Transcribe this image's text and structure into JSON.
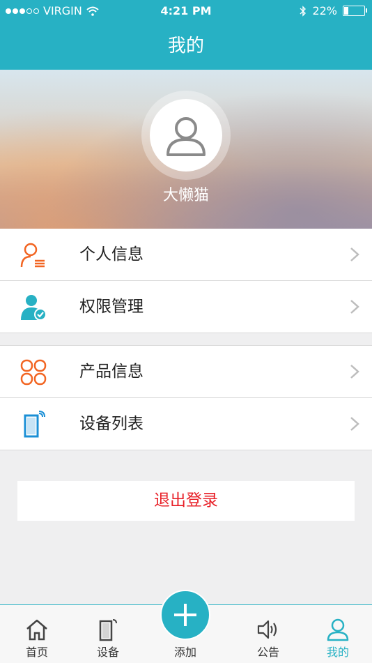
{
  "status_bar": {
    "carrier": "VIRGIN",
    "time": "4:21 PM",
    "battery": "22%",
    "battery_level": 0.22
  },
  "nav": {
    "title": "我的"
  },
  "profile": {
    "username": "大懒猫"
  },
  "menu": {
    "group1": [
      {
        "label": "个人信息",
        "icon": "personal-info-icon"
      },
      {
        "label": "权限管理",
        "icon": "permission-icon"
      }
    ],
    "group2": [
      {
        "label": "产品信息",
        "icon": "product-info-icon"
      },
      {
        "label": "设备列表",
        "icon": "device-list-icon"
      }
    ]
  },
  "logout_label": "退出登录",
  "tabs": [
    {
      "label": "首页",
      "icon": "home-icon"
    },
    {
      "label": "设备",
      "icon": "device-icon"
    },
    {
      "label": "添加",
      "icon": "plus-icon"
    },
    {
      "label": "公告",
      "icon": "speaker-icon"
    },
    {
      "label": "我的",
      "icon": "user-icon",
      "active": true
    }
  ],
  "colors": {
    "primary": "#27b1c4",
    "logout": "#e8222a",
    "orange": "#f26522",
    "blue": "#1a8fd6"
  }
}
